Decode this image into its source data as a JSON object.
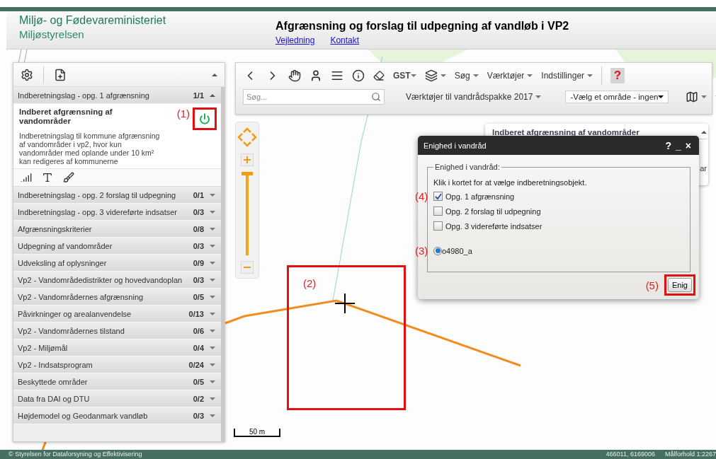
{
  "header": {
    "ministry": "Miljø- og Fødevareministeriet",
    "agency": "Miljøstyrelsen",
    "title": "Afgrænsning og forslag til udpegning af vandløb i VP2",
    "links": [
      "Vejledning",
      "Kontakt"
    ]
  },
  "layers": [
    {
      "name": "Indberetningslag - opg. 1 afgrænsning",
      "count": "1/1",
      "expanded": true,
      "child": {
        "title": "Indberet afgrænsning af vandområder",
        "description": "Indberetningslag til kommune afgrænsning af vandområder i vp2, hvor kun vandområder med oplande under 10 km² kan redigeres af kommunerne",
        "power_on": true,
        "highlighted": true,
        "annotation": "(1)"
      }
    },
    {
      "name": "Indberetningslag - opg. 2 forslag til udpegning",
      "count": "0/1",
      "expanded": false
    },
    {
      "name": "Indberetningslag - opg. 3 videreførte indsatser",
      "count": "0/3",
      "expanded": false
    },
    {
      "name": "Afgrænsningskriterier",
      "count": "0/8",
      "expanded": false
    },
    {
      "name": "Udpegning af vandområder",
      "count": "0/3",
      "expanded": false
    },
    {
      "name": "Udveksling af oplysninger",
      "count": "0/9",
      "expanded": false
    },
    {
      "name": "Vp2 - Vandområdedistrikter og hovedvandoplan",
      "count": "0/3",
      "expanded": false
    },
    {
      "name": "Vp2 - Vandområdernes afgrænsning",
      "count": "0/5",
      "expanded": false
    },
    {
      "name": "Påvirkninger og arealanvendelse",
      "count": "0/13",
      "expanded": false
    },
    {
      "name": "Vp2 - Vandområdernes tilstand",
      "count": "0/6",
      "expanded": false
    },
    {
      "name": "Vp2 - Miljømål",
      "count": "0/4",
      "expanded": false
    },
    {
      "name": "Vp2 - Indsatsprogram",
      "count": "0/24",
      "expanded": false
    },
    {
      "name": "Beskyttede områder",
      "count": "0/5",
      "expanded": false
    },
    {
      "name": "Data fra DAI og DTU",
      "count": "0/2",
      "expanded": false
    },
    {
      "name": "Højdemodel og Geodanmark vandløb",
      "count": "0/3",
      "expanded": false
    }
  ],
  "toolbar": {
    "gst": "GST",
    "menus": [
      "Søg",
      "Værktøjer",
      "Indstillinger"
    ],
    "help": "?",
    "search_placeholder": "Søg...",
    "tools_menu": "Værktøjer til vandrådspakke 2017",
    "area_select": "-Vælg et område - ingen"
  },
  "info_panel": {
    "title": "Indberet afgrænsning af vandområder",
    "fragment": "ar"
  },
  "dialog": {
    "title": "Enighed i vandråd",
    "controls": [
      "?",
      "_",
      "×"
    ],
    "legend": "Enighed i vandråd:",
    "instruction": "Klik i kortet for at vælge indberetningsobjekt.",
    "options": [
      {
        "label": "Opg. 1 afgrænsning",
        "checked": true,
        "annotation": "(4)"
      },
      {
        "label": "Opg. 2 forslag til udpegning",
        "checked": false
      },
      {
        "label": "Opg. 3 videreførte indsatser",
        "checked": false
      }
    ],
    "object": {
      "label": "o4980_a",
      "selected": true,
      "annotation": "(3)"
    },
    "button": {
      "label": "Enig",
      "highlighted": true,
      "annotation": "(5)"
    }
  },
  "map": {
    "annotation": "(2)",
    "scale": "50 m",
    "zoom": {
      "level": 1
    }
  },
  "footer": {
    "copyright": "© Styrelsen for Dataforsyning og Effektivisering",
    "coordinates": "466011, 6169006",
    "scale": "Målforhold 1:2267"
  }
}
